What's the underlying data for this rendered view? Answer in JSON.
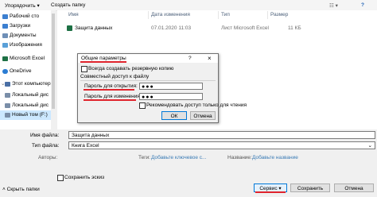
{
  "toolbar": {
    "organize": "Упорядочить ▾",
    "new_folder": "Создать папку"
  },
  "sidebar": {
    "items": [
      {
        "label": "Рабочий сто",
        "color": "#3c7fd0"
      },
      {
        "label": "Загрузки",
        "color": "#3c7fd0"
      },
      {
        "label": "Документы",
        "color": "#6f8fb7"
      },
      {
        "label": "Изображения",
        "color": "#5aa0d8"
      },
      {
        "label": "Microsoft Excel",
        "color": "#1d7044"
      },
      {
        "label": "OneDrive",
        "color": "#2b7cd3"
      },
      {
        "label": "Этот компьютер",
        "color": "#4a6fa5"
      },
      {
        "label": "Локальный дис",
        "color": "#7a8ea8"
      },
      {
        "label": "Локальный дис",
        "color": "#7a8ea8"
      },
      {
        "label": "Новый том (F:)",
        "color": "#7a8ea8"
      }
    ]
  },
  "columns": {
    "name": "Имя",
    "date": "Дата изменения",
    "type": "Тип",
    "size": "Размер"
  },
  "file": {
    "name": "Защита данных",
    "date": "07.01.2020 11:03",
    "type": "Лист Microsoft Excel",
    "size": "11 КБ"
  },
  "dialog": {
    "title": "Общие параметры",
    "help": "?",
    "close": "×",
    "backup_label": "Всегда создавать резервную копию",
    "section": "Совместный доступ к файлу",
    "open_pw_label": "Пароль для открытия:",
    "open_pw_value": "●●●",
    "modify_pw_label": "Пароль для изменения:",
    "modify_pw_value": "●●●",
    "readonly_label": "Рекомендовать доступ только для чтения",
    "ok": "ОК",
    "cancel": "Отмена"
  },
  "form": {
    "filename_label": "Имя файла:",
    "filename_value": "Защита данных",
    "filetype_label": "Тип файла:",
    "filetype_value": "Книга Excel",
    "authors_label": "Авторы:",
    "authors_value": "",
    "tags_label": "Теги:",
    "tags_value": "Добавьте ключевое с...",
    "title_label": "Название:",
    "title_value": "Добавьте название",
    "thumb_label": "Сохранить эскиз"
  },
  "footer": {
    "hide_folders": "Скрыть папки",
    "tools": "Сервис",
    "save": "Сохранить",
    "cancel": "Отмена"
  }
}
